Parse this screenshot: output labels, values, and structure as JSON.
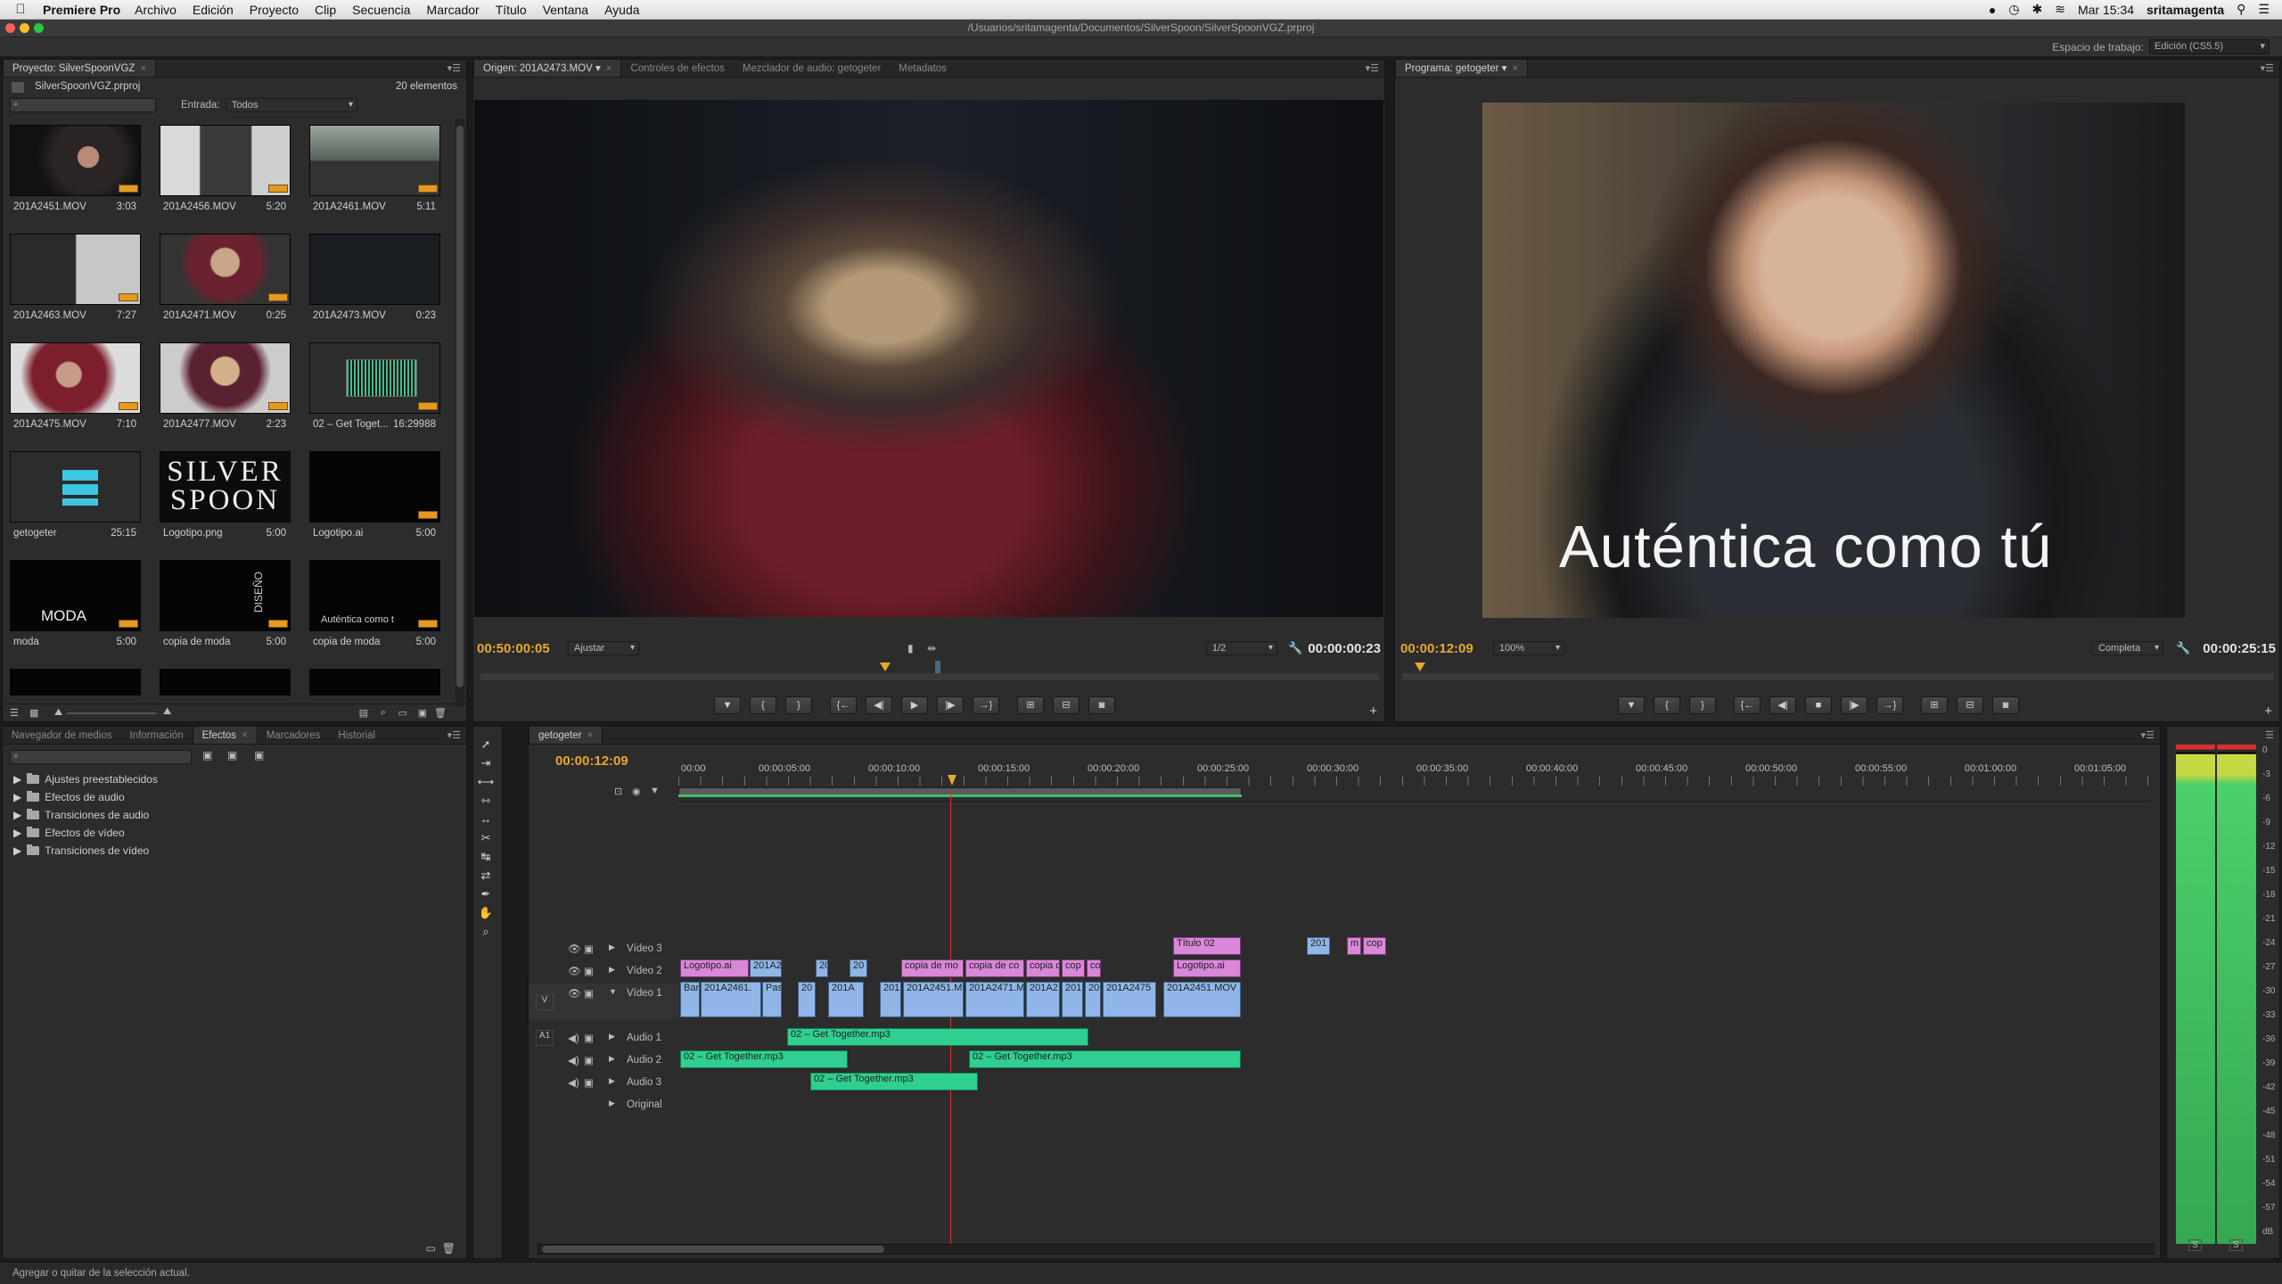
{
  "menubar": {
    "app": "Premiere Pro",
    "items": [
      "Archivo",
      "Edición",
      "Proyecto",
      "Clip",
      "Secuencia",
      "Marcador",
      "Título",
      "Ventana",
      "Ayuda"
    ],
    "clock": "Mar 15:34",
    "user": "sritamagenta"
  },
  "window": {
    "path": "/Usuarios/sritamagenta/Documentos/SilverSpoon/SilverSpoonVGZ.prproj"
  },
  "workspace": {
    "label": "Espacio de trabajo:",
    "value": "Edición (CS5.5)"
  },
  "project": {
    "tab": "Proyecto: SilverSpoonVGZ",
    "file": "SilverSpoonVGZ.prproj",
    "count": "20 elementos",
    "entrada_label": "Entrada:",
    "entrada_value": "Todos",
    "items": [
      {
        "name": "201A2451.MOV",
        "dur": "3:03"
      },
      {
        "name": "201A2456.MOV",
        "dur": "5:20"
      },
      {
        "name": "201A2461.MOV",
        "dur": "5:11"
      },
      {
        "name": "201A2463.MOV",
        "dur": "7:27"
      },
      {
        "name": "201A2471.MOV",
        "dur": "0:25"
      },
      {
        "name": "201A2473.MOV",
        "dur": "0:23"
      },
      {
        "name": "201A2475.MOV",
        "dur": "7:10"
      },
      {
        "name": "201A2477.MOV",
        "dur": "2:23"
      },
      {
        "name": "02 – Get Toget...",
        "dur": "16:29988"
      },
      {
        "name": "getogeter",
        "dur": "25:15"
      },
      {
        "name": "Logotipo.png",
        "dur": "5:00"
      },
      {
        "name": "Logotipo.ai",
        "dur": "5:00"
      },
      {
        "name": "moda",
        "dur": "5:00"
      },
      {
        "name": "copia de moda",
        "dur": "5:00"
      },
      {
        "name": "copia de moda",
        "dur": "5:00"
      }
    ],
    "thumb_texts": {
      "silver": "SILVER",
      "spoon": "SPOON",
      "moda": "MODA",
      "diseno": "DISEÑO",
      "autentica": "Auténtica como t"
    }
  },
  "source": {
    "tabs": [
      "Origen: 201A2473.MOV",
      "Controles de efectos",
      "Mezclador de audio: getogeter",
      "Metadatos"
    ],
    "timecode_in": "00:50:00:05",
    "fit": "Ajustar",
    "resolution": "1/2",
    "timecode_dur": "00:00:00:23"
  },
  "program": {
    "tab": "Programa: getogeter",
    "overlay": "Auténtica como tú",
    "timecode_in": "00:00:12:09",
    "zoom": "100%",
    "quality": "Completa",
    "timecode_dur": "00:00:25:15"
  },
  "effects": {
    "tabs": [
      "Navegador de medios",
      "Información",
      "Efectos",
      "Marcadores",
      "Historial"
    ],
    "folders": [
      "Ajustes preestablecidos",
      "Efectos de audio",
      "Transiciones de audio",
      "Efectos de vídeo",
      "Transiciones de vídeo"
    ]
  },
  "timeline": {
    "tab": "getogeter",
    "timecode": "00:00:12:09",
    "ruler": [
      "00:00",
      "00:00:05:00",
      "00:00:10:00",
      "00:00:15:00",
      "00:00:20:00",
      "00:00:25:00",
      "00:00:30:00",
      "00:00:35:00",
      "00:00:40:00",
      "00:00:45:00",
      "00:00:50:00",
      "00:00:55:00",
      "00:01:00:00",
      "00:01:05:00"
    ],
    "tracks": {
      "v3": "Vídeo 3",
      "v2": "Vídeo 2",
      "v1": "Vídeo 1",
      "a1": "Audio 1",
      "a2": "Audio 2",
      "a3": "Audio 3",
      "orig": "Original",
      "v_badge": "V",
      "a_badge": "A1"
    },
    "clips": {
      "v3a": "201",
      "v3b": "m",
      "v3c": "cop",
      "v2a": "Logotipo.ai",
      "v2b": "201A2",
      "v2c": "20",
      "v2d": "20",
      "v2e": "copia de mo",
      "v2f": "copia de co",
      "v2g": "copia d",
      "v2h": "cop",
      "v2i": "co",
      "v2j": "Título 02",
      "v2k": "Logotipo.ai",
      "v1a": "Barr",
      "v1b": "201A2461.",
      "v1c": "Paso",
      "v1d": "20",
      "v1e": "201A",
      "v1f": "201",
      "v1g": "201A2451.M",
      "v1h": "201A2471.M",
      "v1i": "201A2",
      "v1j": "201",
      "v1k": "20",
      "v1l": "201A2475",
      "v1m": "201A2451.MOV",
      "a1": "02 – Get Together.mp3",
      "a2a": "02 – Get Together.mp3",
      "a2b": "02 – Get Together.mp3",
      "a3": "02 – Get Together.mp3"
    }
  },
  "audio_meter": {
    "scale": [
      "0",
      "-3",
      "-6",
      "-9",
      "-12",
      "-15",
      "-18",
      "-21",
      "-24",
      "-27",
      "-30",
      "-33",
      "-36",
      "-39",
      "-42",
      "-45",
      "-48",
      "-51",
      "-54",
      "-57",
      "dB"
    ],
    "solo": [
      "S",
      "S"
    ]
  },
  "status": "Agregar o quitar de la selección actual."
}
